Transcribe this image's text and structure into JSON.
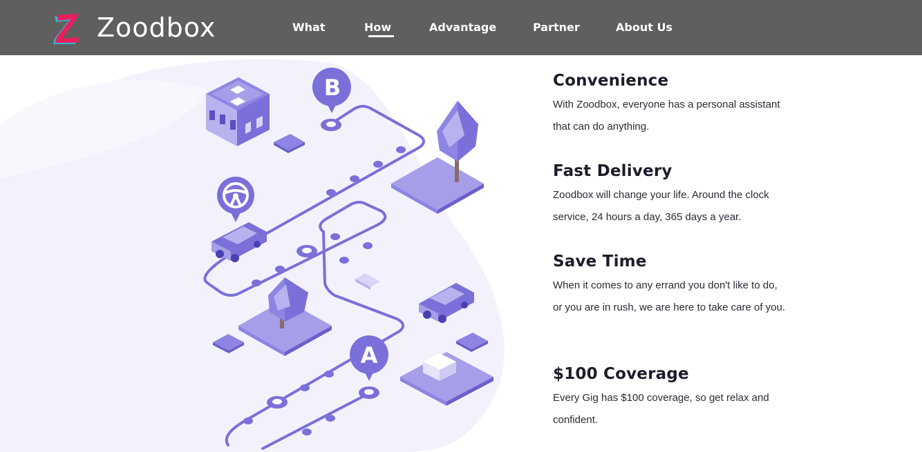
{
  "brand": {
    "name": "Zoodbox",
    "logo_letter": "Z"
  },
  "nav": {
    "items": [
      {
        "label": "What"
      },
      {
        "label": "How"
      },
      {
        "label": "Advantage"
      },
      {
        "label": "Partner"
      },
      {
        "label": "About Us"
      }
    ],
    "active": "How"
  },
  "illustration": {
    "pin_b": "B",
    "pin_a": "A"
  },
  "features": [
    {
      "title": "Convenience",
      "text": "With Zoodbox, everyone has a personal assistant that can do anything."
    },
    {
      "title": "Fast Delivery",
      "text": "Zoodbox will change your life. Around the clock service, 24 hours a day, 365 days a year."
    },
    {
      "title": "Save Time",
      "text": "When it comes to any errand you don't like to do, or you are in rush, we are here to take care of you."
    },
    {
      "title": "$100 Coverage",
      "text": "Every Gig has $100 coverage, so get relax and confident."
    }
  ],
  "colors": {
    "navbar": "#5f5f5f",
    "accent": "#7b6fd9",
    "accent_light": "#a69ee8",
    "logo_pink": "#ee1d5c",
    "logo_cyan": "#2bb8d6",
    "heading": "#1c1c2a"
  }
}
